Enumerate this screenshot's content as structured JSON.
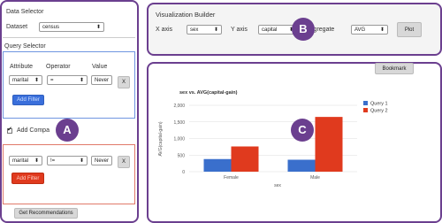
{
  "left_panel": {
    "data_selector_title": "Data Selector",
    "dataset_label": "Dataset",
    "dataset_value": "census",
    "query_selector_title": "Query Selector",
    "headers": [
      "Attribute",
      "Operator",
      "Value"
    ],
    "query1": {
      "attribute": "marital",
      "operator": "=",
      "value": "Never",
      "remove_label": "X",
      "add_filter_label": "Add Filter"
    },
    "add_comparison_label": "Add Compa",
    "query2": {
      "attribute": "marital",
      "operator": "!=",
      "value": "Never",
      "remove_label": "X",
      "add_filter_label": "Add Filter"
    },
    "get_recommendations_label": "Get Recommendations",
    "badge": "A"
  },
  "viz_builder": {
    "title": "Visualization Builder",
    "x_axis_label": "X axis",
    "x_axis_value": "sex",
    "y_axis_label": "Y axis",
    "y_axis_value": "capital",
    "aggregate_label": "Aggregate",
    "aggregate_value": "AVG",
    "plot_label": "Plot",
    "badge": "B"
  },
  "chart_panel": {
    "bookmark_label": "Bookmark",
    "badge": "C"
  },
  "colors": {
    "accent": "#6b3f8f",
    "query1": "#3a6fcc",
    "query2": "#e03a1e",
    "add_filter_blue": "#3a6fdb",
    "add_filter_red": "#e03a1e"
  },
  "chart_data": {
    "type": "bar",
    "title": "sex vs. AVG(capital-gain)",
    "xlabel": "sex",
    "ylabel": "AVG(capital-gain)",
    "categories": [
      "Female",
      "Male"
    ],
    "ylim": [
      0,
      2000
    ],
    "yticks": [
      0,
      500,
      1000,
      1500,
      2000
    ],
    "ytick_labels": [
      "0",
      "500",
      "1,000",
      "1,500",
      "2,000"
    ],
    "series": [
      {
        "name": "Query 1",
        "color": "#3a6fcc",
        "values": [
          380,
          360
        ]
      },
      {
        "name": "Query 2",
        "color": "#e03a1e",
        "values": [
          760,
          1650
        ]
      }
    ],
    "legend": "top-right"
  }
}
